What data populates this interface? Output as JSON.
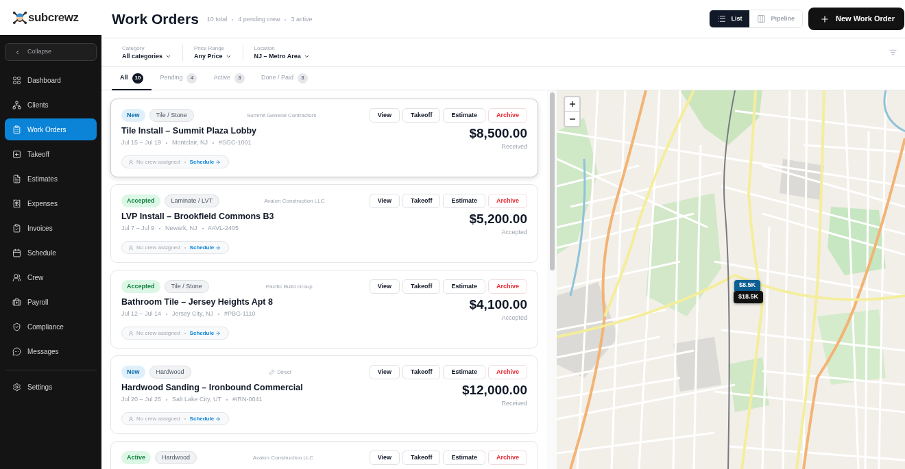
{
  "brand": {
    "name": "subcrewz"
  },
  "header": {
    "title": "Work Orders",
    "stats": [
      "10 total",
      "4 pending crew",
      "3 active"
    ],
    "view_toggle": [
      {
        "label": "List",
        "selected": true
      },
      {
        "label": "Pipeline",
        "selected": false
      }
    ],
    "primary_button": "New Work Order"
  },
  "sidebar": {
    "collapse": "Collapse",
    "items": [
      {
        "label": "Dashboard",
        "selected": false
      },
      {
        "label": "Clients",
        "selected": false
      },
      {
        "label": "Work Orders",
        "selected": true
      },
      {
        "label": "Takeoff",
        "selected": false
      },
      {
        "label": "Estimates",
        "selected": false
      },
      {
        "label": "Expenses",
        "selected": false
      },
      {
        "label": "Invoices",
        "selected": false
      },
      {
        "label": "Schedule",
        "selected": false
      },
      {
        "label": "Crew",
        "selected": false
      },
      {
        "label": "Payroll",
        "selected": false
      },
      {
        "label": "Compliance",
        "selected": false
      },
      {
        "label": "Messages",
        "selected": false
      }
    ],
    "footer_items": [
      {
        "label": "Settings",
        "selected": false
      }
    ]
  },
  "filters": [
    {
      "label": "Category",
      "value": "All categories"
    },
    {
      "label": "Price Range",
      "value": "Any Price"
    },
    {
      "label": "Location",
      "value": "NJ – Metro Area"
    }
  ],
  "tabs": [
    {
      "label": "All",
      "count": "10",
      "selected": true
    },
    {
      "label": "Pending",
      "count": "4",
      "selected": false
    },
    {
      "label": "Active",
      "count": "3",
      "selected": false
    },
    {
      "label": "Done / Paid",
      "count": "3",
      "selected": false
    }
  ],
  "work_orders": [
    {
      "selected": true,
      "status": {
        "kind": "new",
        "label": "New"
      },
      "category": "Tile / Stone",
      "source": {
        "kind": "client",
        "label": "Summit General Contractors"
      },
      "actions": [
        {
          "kind": "default",
          "label": "View"
        },
        {
          "kind": "default",
          "label": "Takeoff"
        },
        {
          "kind": "default",
          "label": "Estimate"
        },
        {
          "kind": "danger",
          "label": "Archive"
        }
      ],
      "title": "Tile Install – Summit Plaza Lobby",
      "meta": [
        "Jul 15 – Jul 19",
        "Montclair, NJ",
        "#SGC-1001"
      ],
      "crew": {
        "text": "No crew assigned",
        "link": "Schedule"
      },
      "amount": "$8,500.00",
      "payment_status": "Received"
    },
    {
      "selected": false,
      "status": {
        "kind": "accepted",
        "label": "Accepted"
      },
      "category": "Laminate / LVT",
      "source": {
        "kind": "client",
        "label": "Avalon Construction LLC"
      },
      "actions": [
        {
          "kind": "default",
          "label": "View"
        },
        {
          "kind": "default",
          "label": "Takeoff"
        },
        {
          "kind": "default",
          "label": "Estimate"
        },
        {
          "kind": "danger",
          "label": "Archive"
        }
      ],
      "title": "LVP Install – Brookfield Commons B3",
      "meta": [
        "Jul 7 – Jul 9",
        "Newark, NJ",
        "#AVL-2405"
      ],
      "crew": {
        "text": "No crew assigned",
        "link": "Schedule"
      },
      "amount": "$5,200.00",
      "payment_status": "Accepted"
    },
    {
      "selected": false,
      "status": {
        "kind": "accepted",
        "label": "Accepted"
      },
      "category": "Tile / Stone",
      "source": {
        "kind": "client",
        "label": "Pacific Build Group"
      },
      "actions": [
        {
          "kind": "default",
          "label": "View"
        },
        {
          "kind": "default",
          "label": "Takeoff"
        },
        {
          "kind": "default",
          "label": "Estimate"
        },
        {
          "kind": "danger",
          "label": "Archive"
        }
      ],
      "title": "Bathroom Tile – Jersey Heights Apt 8",
      "meta": [
        "Jul 12 – Jul 14",
        "Jersey City, NJ",
        "#PBG-1110"
      ],
      "crew": {
        "text": "No crew assigned",
        "link": "Schedule"
      },
      "amount": "$4,100.00",
      "payment_status": "Accepted"
    },
    {
      "selected": false,
      "status": {
        "kind": "new",
        "label": "New"
      },
      "category": "Hardwood",
      "source": {
        "kind": "direct",
        "label": "Direct"
      },
      "actions": [
        {
          "kind": "default",
          "label": "View"
        },
        {
          "kind": "default",
          "label": "Takeoff"
        },
        {
          "kind": "default",
          "label": "Estimate"
        },
        {
          "kind": "danger",
          "label": "Archive"
        }
      ],
      "title": "Hardwood Sanding – Ironbound Commercial",
      "meta": [
        "Jul 20 – Jul 25",
        "Salt Lake City, UT",
        "#IRN-0041"
      ],
      "crew": {
        "text": "No crew assigned",
        "link": "Schedule"
      },
      "amount": "$12,000.00",
      "payment_status": "Received"
    },
    {
      "selected": false,
      "status": {
        "kind": "active",
        "label": "Active"
      },
      "category": "Hardwood",
      "source": {
        "kind": "client",
        "label": "Avalon Construction LLC"
      },
      "actions": [
        {
          "kind": "default",
          "label": "View"
        },
        {
          "kind": "default",
          "label": "Takeoff"
        },
        {
          "kind": "default",
          "label": "Estimate"
        },
        {
          "kind": "danger",
          "label": "Archive"
        }
      ]
    }
  ],
  "map": {
    "pins": [
      {
        "label": "$8.5K",
        "selected": true
      },
      {
        "label": "$18.5K",
        "selected": false
      }
    ]
  }
}
